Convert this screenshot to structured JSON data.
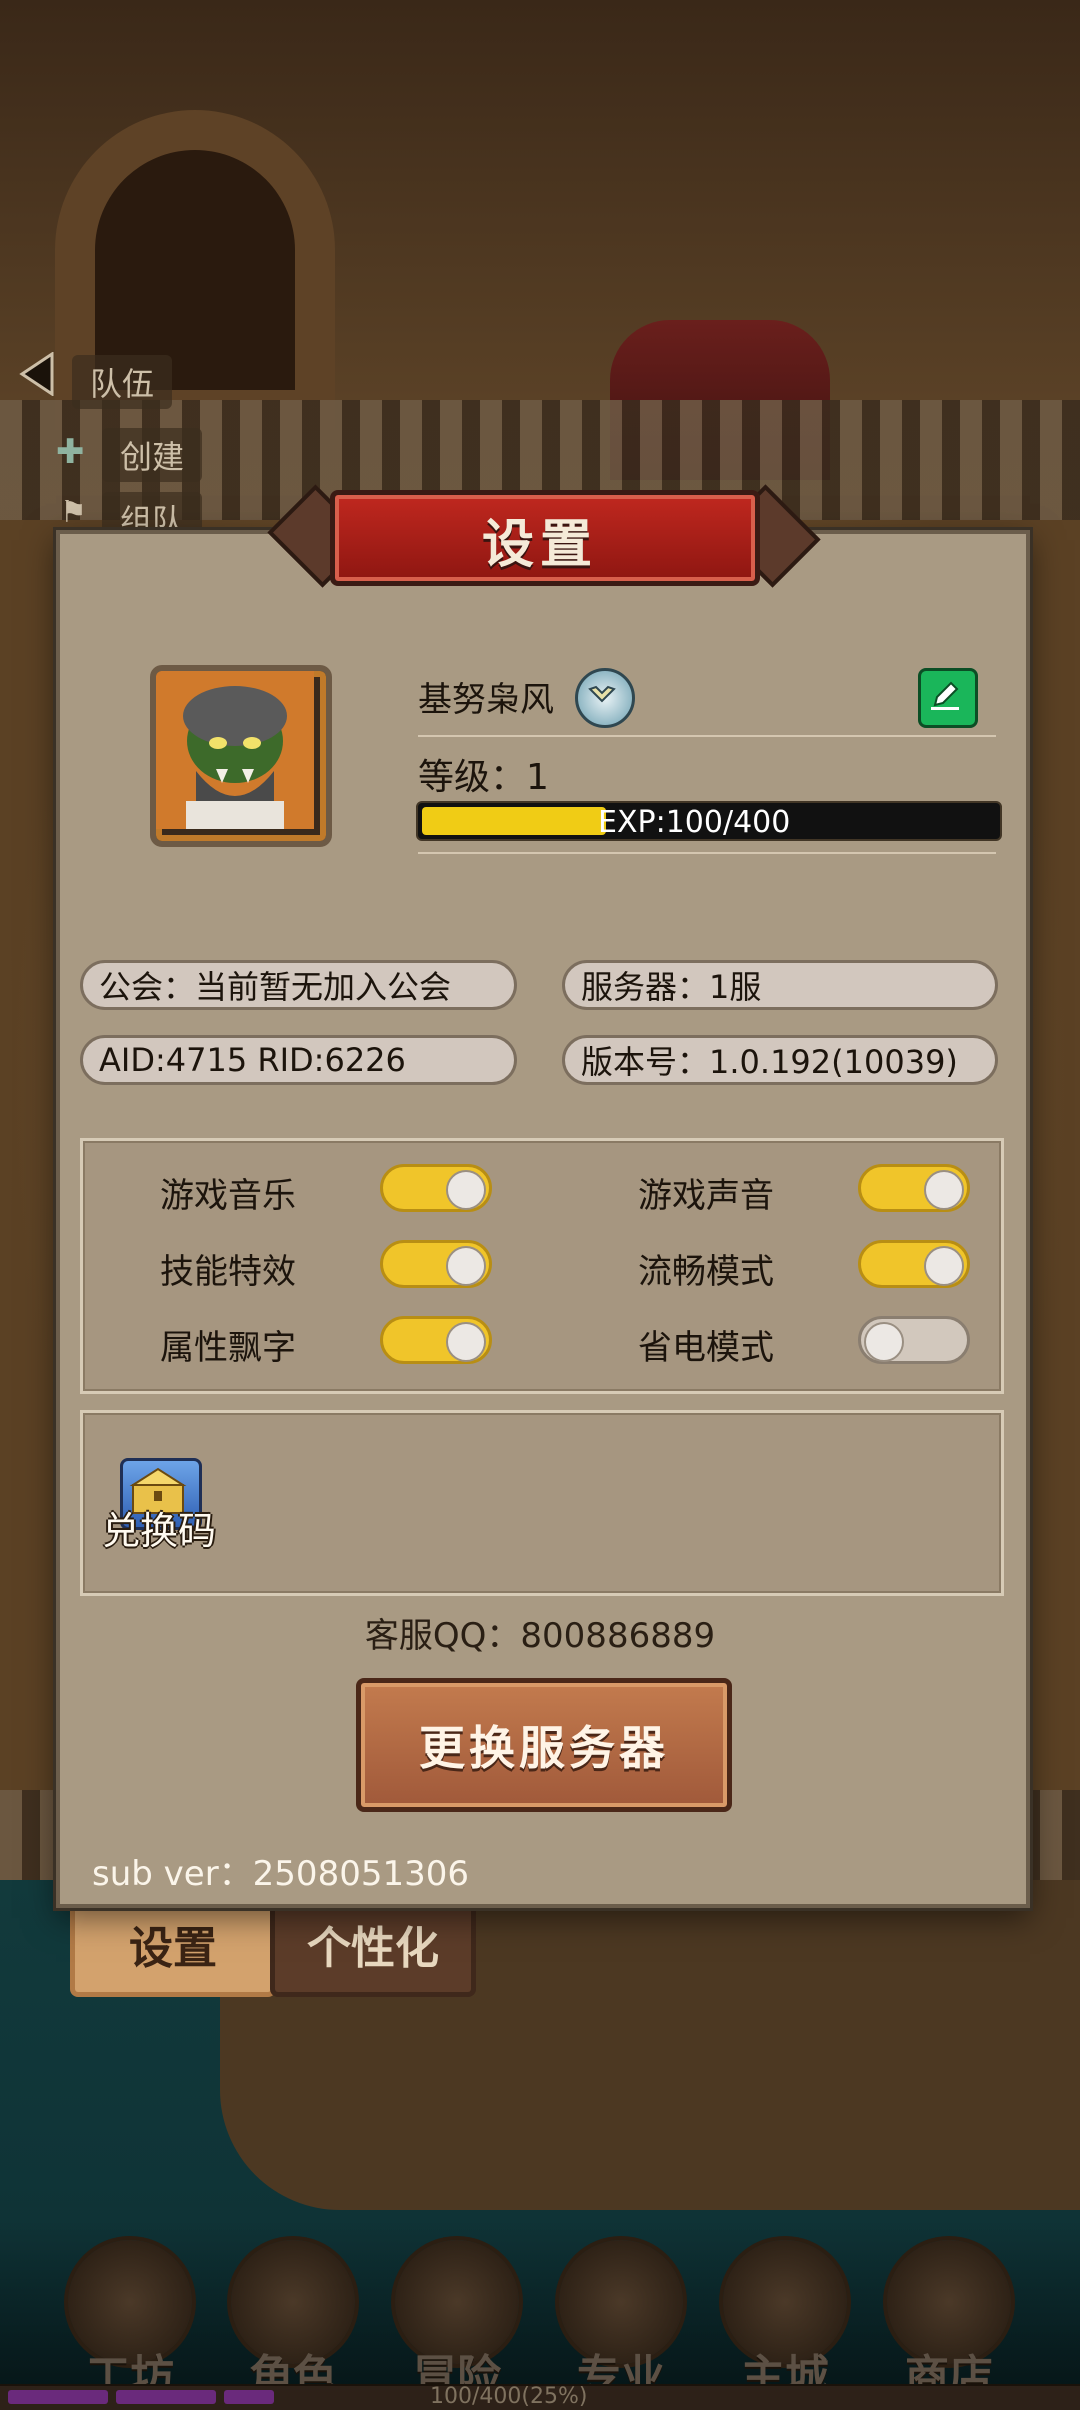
{
  "side_menu": {
    "team": "队伍",
    "create": "创建",
    "group": "组队"
  },
  "dialog": {
    "title": "设置",
    "player_name": "基努枭风",
    "level_text": "等级：1",
    "exp_text": "EXP:100/400",
    "exp_fraction": 0.25,
    "guild": "公会：当前暂无加入公会",
    "server": "服务器：1服",
    "ids": "AID:4715   RID:6226",
    "version": "版本号：1.0.192(10039)",
    "toggles": [
      {
        "label": "游戏音乐",
        "on": true
      },
      {
        "label": "游戏声音",
        "on": true
      },
      {
        "label": "技能特效",
        "on": true
      },
      {
        "label": "流畅模式",
        "on": true
      },
      {
        "label": "属性飘字",
        "on": true
      },
      {
        "label": "省电模式",
        "on": false
      }
    ],
    "redeem_label": "兑换码",
    "cs_qq": "客服QQ：800886889",
    "change_server": "更换服务器",
    "sub_ver": "sub ver：2508051306"
  },
  "tabs": {
    "settings": "设置",
    "personalize": "个性化"
  },
  "bottom_nav": [
    "工坊",
    "角色",
    "冒险",
    "专业",
    "主城",
    "商店"
  ],
  "xp_strip_text": "100/400(25%)",
  "colors": {
    "toggle_on": "#f0c52a",
    "toggle_off": "#d2c8bd",
    "exp_fill": "#f0cc15",
    "title_red": "#c0281f",
    "edit_green": "#1ab65a"
  }
}
